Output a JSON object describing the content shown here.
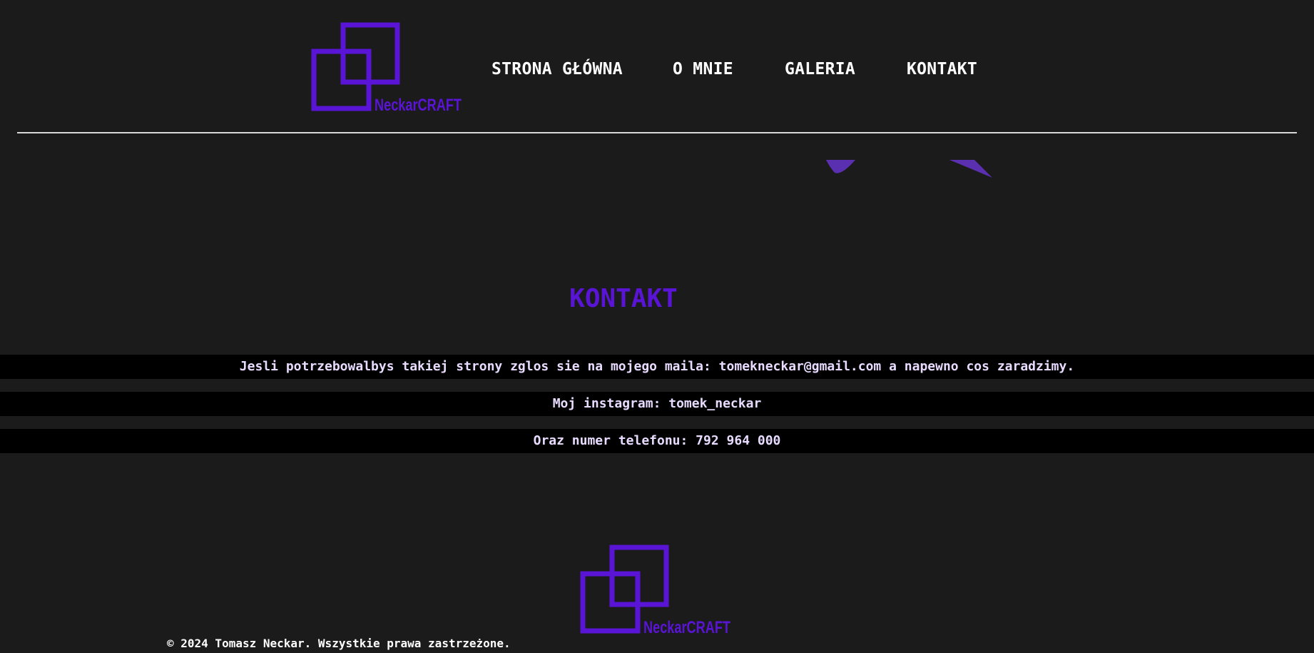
{
  "brand": {
    "name": "NeckarCRAFT",
    "color": "#5a14d6"
  },
  "nav": {
    "items": [
      {
        "label": "STRONA GŁÓWNA"
      },
      {
        "label": "O MNIE"
      },
      {
        "label": "GALERIA"
      },
      {
        "label": "KONTAKT"
      }
    ]
  },
  "main": {
    "title": "KONTAKT",
    "lines": [
      {
        "text": "Jesli potrzebowalbys takiej strony zglos sie na mojego maila: tomekneckar@gmail.com a napewno cos zaradzimy."
      },
      {
        "text": "Moj instagram: tomek_neckar"
      },
      {
        "text": "Oraz numer telefonu: 792 964 000"
      }
    ]
  },
  "footer": {
    "copyright": "© 2024 Tomasz Neckar. Wszystkie prawa zastrzeżone."
  },
  "colors": {
    "background": "#1b1b1b",
    "accent": "#5a14d6",
    "bar": "#000000",
    "bar_text": "#e8dbff"
  }
}
